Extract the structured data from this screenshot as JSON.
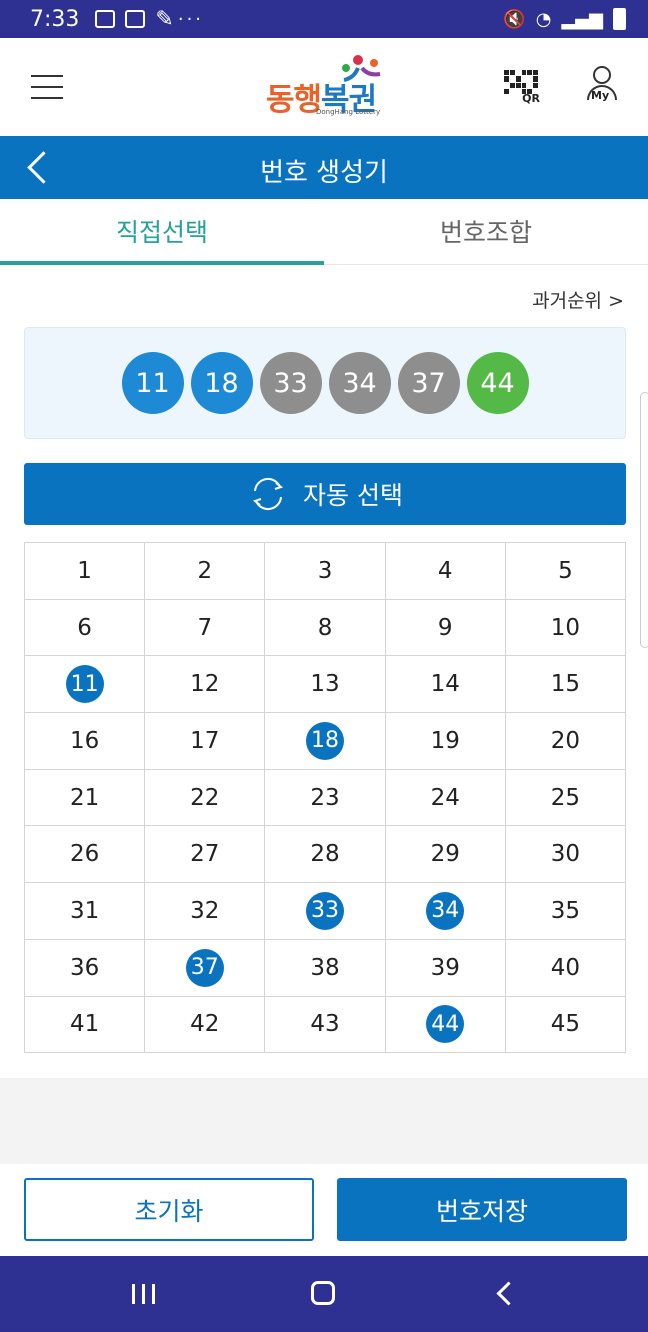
{
  "status": {
    "time": "7:33",
    "dots": "···"
  },
  "header": {
    "logo_text_a": "동행",
    "logo_text_b": "복권",
    "logo_sub": "DongHang Lottery",
    "qr_label": "QR",
    "my_label": "My"
  },
  "titlebar": {
    "title": "번호 생성기"
  },
  "tabs": [
    {
      "label": "직접선택",
      "active": true
    },
    {
      "label": "번호조합",
      "active": false
    }
  ],
  "past_link": "과거순위 >",
  "selected_balls": [
    {
      "number": "11",
      "color": "#1e8ad6"
    },
    {
      "number": "18",
      "color": "#1e8ad6"
    },
    {
      "number": "33",
      "color": "#8e8e8e"
    },
    {
      "number": "34",
      "color": "#8e8e8e"
    },
    {
      "number": "37",
      "color": "#8e8e8e"
    },
    {
      "number": "44",
      "color": "#54b947"
    }
  ],
  "auto_button": {
    "label": "자동 선택"
  },
  "number_grid": {
    "numbers": [
      "1",
      "2",
      "3",
      "4",
      "5",
      "6",
      "7",
      "8",
      "9",
      "10",
      "11",
      "12",
      "13",
      "14",
      "15",
      "16",
      "17",
      "18",
      "19",
      "20",
      "21",
      "22",
      "23",
      "24",
      "25",
      "26",
      "27",
      "28",
      "29",
      "30",
      "31",
      "32",
      "33",
      "34",
      "35",
      "36",
      "37",
      "38",
      "39",
      "40",
      "41",
      "42",
      "43",
      "44",
      "45"
    ],
    "selected": [
      "11",
      "18",
      "33",
      "34",
      "37",
      "44"
    ]
  },
  "buttons": {
    "reset": "초기화",
    "save": "번호저장"
  },
  "colors": {
    "primary": "#0a73c0",
    "accent": "#25a39b",
    "system_bar": "#2e3192"
  }
}
